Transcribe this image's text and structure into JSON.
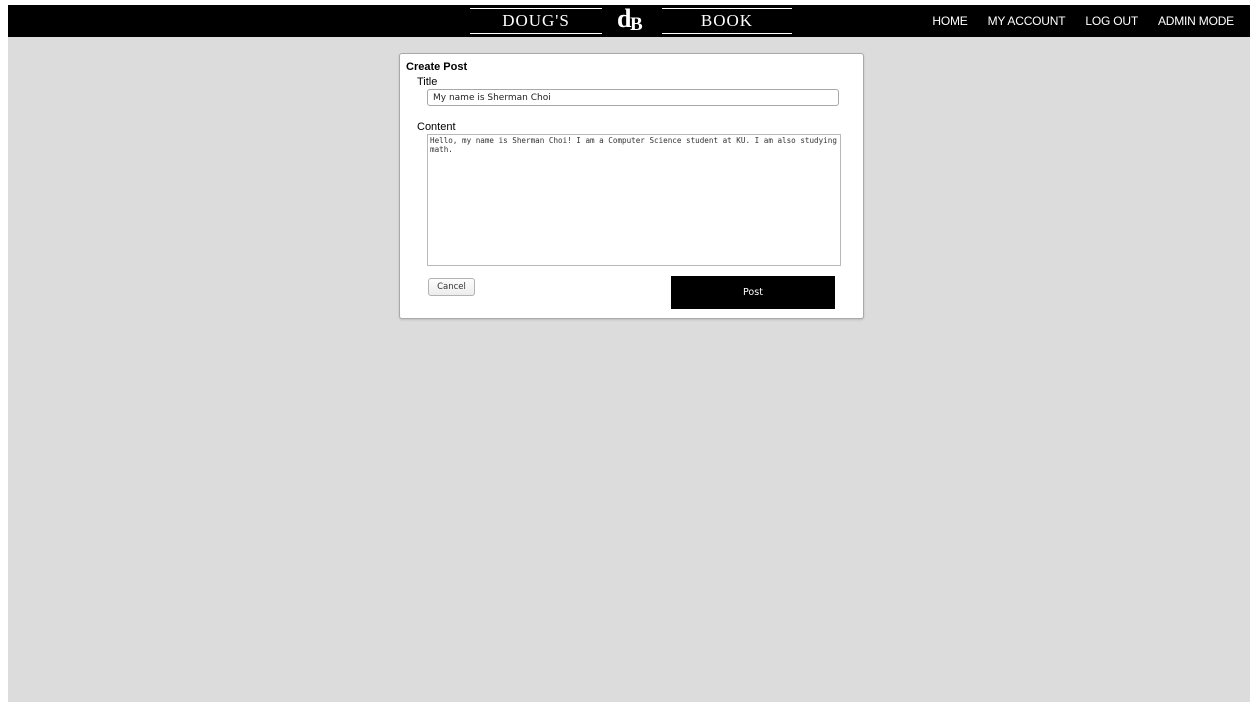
{
  "brand": {
    "left_word": "DOUG'S",
    "mark_d": "d",
    "mark_b": "B",
    "right_word": "BOOK"
  },
  "nav": {
    "items": [
      "HOME",
      "MY ACCOUNT",
      "LOG OUT",
      "ADMIN MODE"
    ]
  },
  "form": {
    "heading": "Create Post",
    "title_label": "Title",
    "title_value": "My name is Sherman Choi",
    "content_label": "Content",
    "content_value": "Hello, my name is Sherman Choi! I am a Computer Science student at KU. I am also studying math.",
    "cancel_label": "Cancel",
    "post_label": "Post"
  },
  "colors": {
    "topbar": "#000000",
    "page_background": "#dcdcdc",
    "card_background": "#ffffff",
    "post_button": "#000000"
  }
}
